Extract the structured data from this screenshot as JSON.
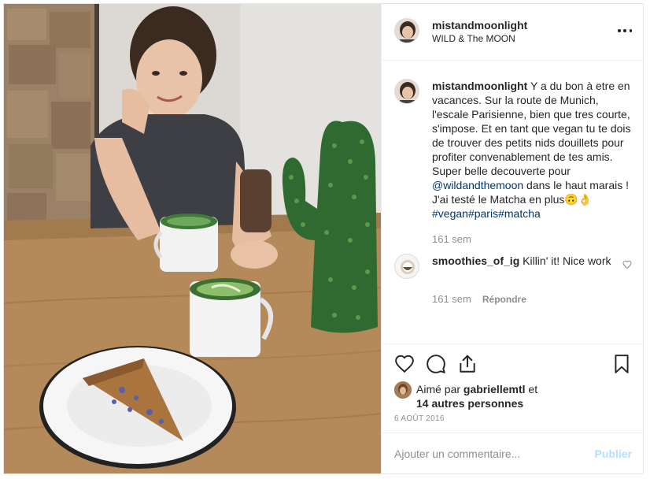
{
  "post": {
    "author": {
      "username": "mistandmoonlight",
      "location": "WILD & The MOON"
    },
    "more_icon": "more-horizontal-icon",
    "caption": {
      "username": "mistandmoonlight",
      "text_1": " Y a du bon à etre en vacances. Sur la route de Munich, l'escale Parisienne, bien que tres courte, s'impose. Et en tant que vegan tu te dois de trouver des petits nids douillets pour profiter convenablement de tes amis. Super belle decouverte pour ",
      "mention": "@wildandthemoon",
      "text_2": " dans le haut marais ! J'ai testé le Matcha en plus🙃👌",
      "tags": [
        "#vegan",
        "#paris",
        "#matcha"
      ],
      "age": "161 sem"
    },
    "comments": [
      {
        "username": "smoothies_of_ig",
        "text": " Killin' it! Nice work",
        "age": "161 sem",
        "reply_label": "Répondre"
      }
    ],
    "actions": {
      "like_icon": "heart-icon",
      "comment_icon": "comment-icon",
      "share_icon": "share-icon",
      "save_icon": "bookmark-icon"
    },
    "likes": {
      "prefix": "Aimé par ",
      "user": "gabriellemtl",
      "mid": " et",
      "others": "14 autres personnes"
    },
    "date": "6 août 2016",
    "add_comment": {
      "placeholder": "Ajouter un commentaire...",
      "publish_label": "Publier"
    }
  },
  "colors": {
    "link": "#00376b",
    "muted": "#8e8e8e",
    "publish_disabled": "#b2dffc",
    "border": "#efefef"
  }
}
